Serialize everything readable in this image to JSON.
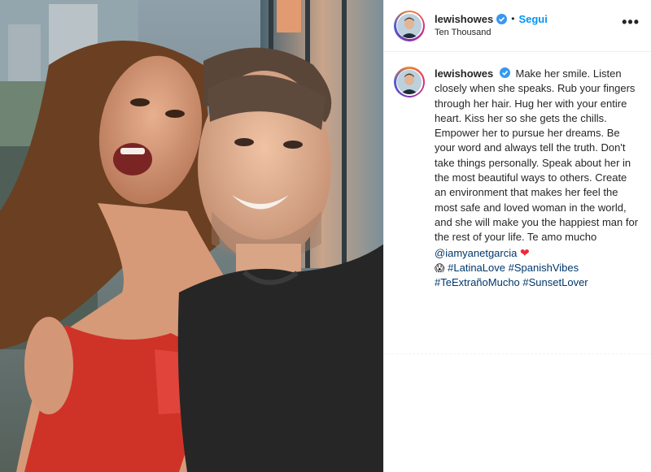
{
  "header": {
    "username": "lewishowes",
    "dot": "•",
    "follow_label": "Segui",
    "subtitle": "Ten Thousand",
    "more_label": "•••"
  },
  "caption": {
    "username": "lewishowes",
    "text": "Make her smile. Listen closely when she speaks. Rub your fingers through her hair. Hug her with your entire heart. Kiss her so she gets the chills. Empower her to pursue her dreams. Be your word and always tell the truth. Don't take things personally. Speak about her in the most beautiful ways to others. Create an environment that makes her feel the most safe and loved woman in the world, and she will make you the happiest man for the rest of your life. Te amo mucho",
    "mention": "@iamyanetgarcia",
    "heart": "❤",
    "emoji": "😱",
    "hashtags": [
      "#LatinaLove",
      "#SpanishVibes",
      "#TeExtrañoMucho",
      "#SunsetLover"
    ]
  },
  "icons": {
    "verified": "verified-badge-icon",
    "more": "more-options-icon"
  },
  "colors": {
    "accent": "#0095f6",
    "verified": "#3897f0",
    "link": "#00376b",
    "text": "#262626"
  }
}
